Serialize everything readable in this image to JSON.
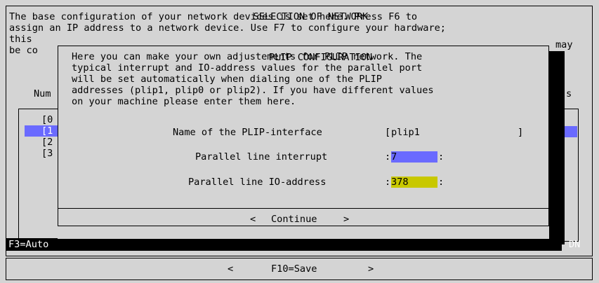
{
  "background_window": {
    "title": "SELECTION OF NETWORK",
    "text_lines": [
      "The base configuration of your network devices is set here. Press F6 to",
      "assign an IP address to a network device. Use F7 to configure your hardware;"
    ],
    "partial_left": [
      "this",
      "be co",
      "Num"
    ],
    "partial_right": [
      "may",
      "s"
    ],
    "list_items": [
      "[0",
      "[1",
      "[2",
      "[3"
    ],
    "status_bar": "F3=Auto",
    "status_right": "DN",
    "bottom_bar": {
      "left": "<",
      "save": "F10=Save",
      "right": ">"
    }
  },
  "dialog": {
    "title": "PLIP CONFIGURATION",
    "description_lines": [
      "Here you can make your own adjustements for PLIP network. The",
      "typical interrupt and IO-address values for the parallel port",
      "will be set automatically when dialing one of the PLIP",
      "addresses (plip1, plip0 or plip2). If you have different values",
      "on your machine please enter them here."
    ],
    "fields": {
      "interface_label": "Name of the PLIP-interface",
      "interface_open": "[",
      "interface_value": "plip1",
      "interface_close": "]",
      "interrupt_label": "Parallel line interrupt",
      "interrupt_value": "7",
      "io_label": "Parallel line IO-address",
      "io_value": "378",
      "colon": ":"
    },
    "buttons": {
      "prev": "<",
      "continue": "Continue",
      "next": ">"
    }
  }
}
